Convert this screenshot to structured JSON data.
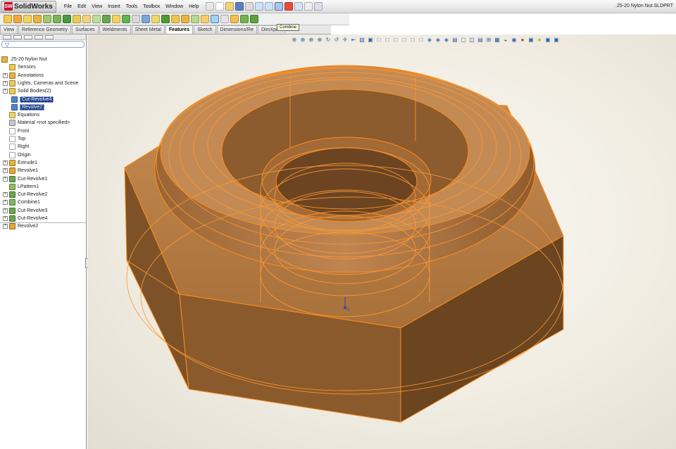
{
  "app": {
    "name": "SolidWorks",
    "logo_mark": "SW",
    "document_title": ".25-20 Nylon Nut.SLDPRT"
  },
  "menu": [
    "File",
    "Edit",
    "View",
    "Insert",
    "Tools",
    "Toolbox",
    "Window",
    "Help"
  ],
  "tooltip": "Combine",
  "tabs": [
    {
      "label": "View",
      "active": false
    },
    {
      "label": "Reference Geometry",
      "active": false
    },
    {
      "label": "Surfaces",
      "active": false
    },
    {
      "label": "Weldments",
      "active": false
    },
    {
      "label": "Sheet Metal",
      "active": false
    },
    {
      "label": "Features",
      "active": true
    },
    {
      "label": "Sketch",
      "active": false
    },
    {
      "label": "Dimensions/Re",
      "active": false
    },
    {
      "label": "DimXpert",
      "active": false
    }
  ],
  "feature_tree": {
    "filter_icon": "funnel-icon",
    "items": [
      {
        "label": ".25-20 Nylon Nut",
        "icon": "part-icon",
        "selected": false
      },
      {
        "label": "Sensors",
        "icon": "sensor-icon",
        "selected": false
      },
      {
        "label": "Annotations",
        "icon": "annotation-icon",
        "selected": false
      },
      {
        "label": "Lights, Cameras and Scene",
        "icon": "lights-icon",
        "selected": false
      },
      {
        "label": "Solid Bodies(2)",
        "icon": "solid-bodies-icon",
        "selected": false
      },
      {
        "label": "Cut-Revolve4",
        "icon": "body-icon",
        "selected": true
      },
      {
        "label": "Revolve2",
        "icon": "body-icon",
        "selected": true
      },
      {
        "label": "Equations",
        "icon": "equations-icon",
        "selected": false
      },
      {
        "label": "Material <not specified>",
        "icon": "material-icon",
        "selected": false
      },
      {
        "label": "Front",
        "icon": "plane-icon",
        "selected": false
      },
      {
        "label": "Top",
        "icon": "plane-icon",
        "selected": false
      },
      {
        "label": "Right",
        "icon": "plane-icon",
        "selected": false
      },
      {
        "label": "Origin",
        "icon": "origin-icon",
        "selected": false
      },
      {
        "label": "Extrude1",
        "icon": "extrude-icon",
        "selected": false
      },
      {
        "label": "Revolve1",
        "icon": "revolve-icon",
        "selected": false
      },
      {
        "label": "Cut-Revolve1",
        "icon": "cut-revolve-icon",
        "selected": false
      },
      {
        "label": "LPattern1",
        "icon": "pattern-icon",
        "selected": false
      },
      {
        "label": "Cut-Revolve2",
        "icon": "cut-revolve-icon",
        "selected": false
      },
      {
        "label": "Combine1",
        "icon": "combine-icon",
        "selected": false
      },
      {
        "label": "Cut-Revolve3",
        "icon": "cut-revolve-icon",
        "selected": false
      },
      {
        "label": "Cut-Revolve4",
        "icon": "cut-revolve-icon",
        "selected": false
      },
      {
        "label": "Revolve2",
        "icon": "revolve-icon",
        "selected": false
      }
    ]
  },
  "colors": {
    "model_fill": "#b97a3e",
    "model_edge": "#ff8c1a",
    "selection": "#1d3f8c"
  }
}
